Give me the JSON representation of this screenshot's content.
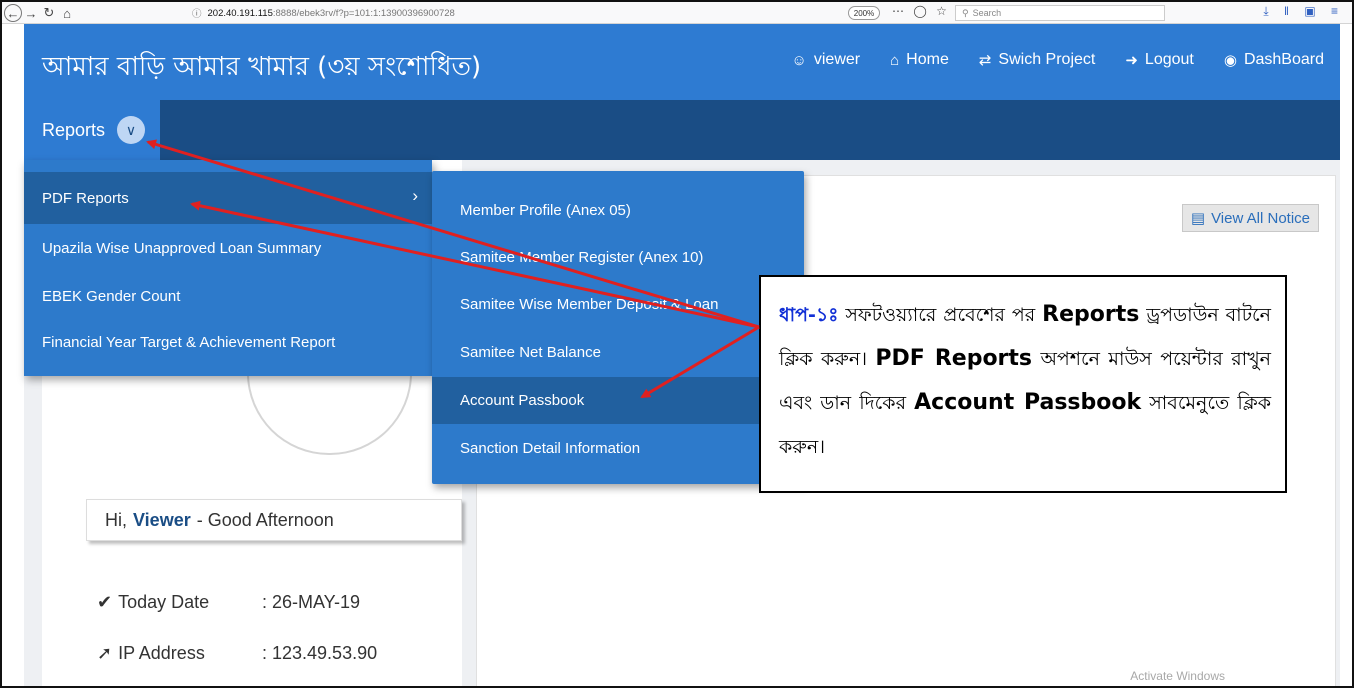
{
  "browser": {
    "url_host": "202.40.191.115",
    "url_path": ":8888/ebek3rv/f?p=101:1:13900396900728",
    "zoom": "200%",
    "search_placeholder": "Search"
  },
  "header": {
    "title": "আমার বাড়ি আমার খামার (৩য় সংশোধিত)",
    "menu": [
      {
        "label": "viewer",
        "icon": "user-icon"
      },
      {
        "label": "Home",
        "icon": "home-icon"
      },
      {
        "label": "Swich Project",
        "icon": "switch-icon"
      },
      {
        "label": "Logout",
        "icon": "logout-icon"
      },
      {
        "label": "DashBoard",
        "icon": "dashboard-icon"
      }
    ]
  },
  "reports_menu": {
    "label": "Reports",
    "items": [
      {
        "label": "PDF Reports",
        "active": true
      },
      {
        "label": "Upazila Wise Unapproved Loan Summary"
      },
      {
        "label": "EBEK Gender Count"
      },
      {
        "label": "Financial Year Target & Achievement Report"
      }
    ]
  },
  "pdf_submenu": {
    "items": [
      {
        "label": "Member Profile (Anex 05)"
      },
      {
        "label": "Samitee Member Register (Anex 10)"
      },
      {
        "label": "Samitee Wise Member Deposit & Loan"
      },
      {
        "label": "Samitee Net Balance"
      },
      {
        "label": "Account Passbook",
        "active": true
      },
      {
        "label": "Sanction Detail Information"
      }
    ]
  },
  "notice": {
    "label": "View All Notice"
  },
  "greeting": {
    "prefix": "Hi,",
    "name": "Viewer",
    "suffix": "- Good Afternoon"
  },
  "info": {
    "date_label": "Today Date",
    "date_value": ": 26-MAY-19",
    "ip_label": "IP Address",
    "ip_value": ": 123.49.53.90"
  },
  "callout": {
    "step": "ধাপ-১ঃ",
    "t1": "সফটওয়্যারে প্রবেশের পর",
    "b1": "Reports",
    "t2": "ড্রপডাউন বাটনে ক্লিক করুন।",
    "b2": "PDF Reports",
    "t3": "অপশনে মাউস পয়েন্টার রাখুন এবং ডান দিকের",
    "b3": "Account Passbook",
    "t4": "সাবমেনুতে ক্লিক করুন।"
  },
  "watermark": "Activate Windows",
  "colors": {
    "header": "#2e7bd2",
    "nav_dark": "#1a4d85",
    "menu": "#2d7acb",
    "arrow": "#e02020"
  }
}
